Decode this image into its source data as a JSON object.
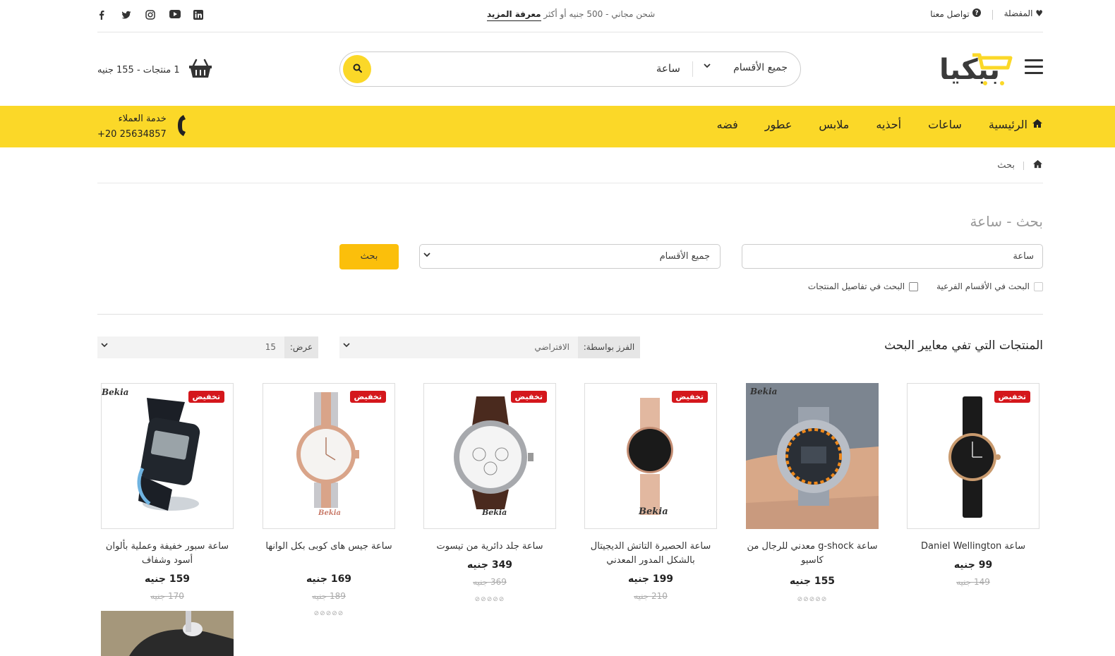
{
  "topbar": {
    "social_icons": [
      "facebook-icon",
      "twitter-icon",
      "instagram-icon",
      "youtube-icon",
      "linkedin-icon"
    ],
    "promo_text": "شحن مجاني - 500 جنيه أو أكثر",
    "promo_link": "معرفة المزيد",
    "favorites": "المفضلة",
    "contact": "تواصل معنا"
  },
  "header": {
    "logo_text": "بيكيا",
    "search": {
      "value": "ساعة",
      "category": "جميع الأقسام"
    },
    "cart": {
      "count": "1",
      "count_label": "منتجات",
      "sep": "-",
      "total": "155 جنيه"
    }
  },
  "nav": {
    "items": [
      "الرئيسية",
      "ساعات",
      "أحذيه",
      "ملابس",
      "عطور",
      "فضه"
    ],
    "support_label": "خدمة العملاء",
    "support_phone": "+20 25634857"
  },
  "breadcrumb": {
    "current": "بحث"
  },
  "search_form": {
    "title": "بحث - ساعة",
    "keyword": "ساعة",
    "category": "جميع الأقسام",
    "button": "بحث",
    "subcategories_label": "البحث في الأقسام الفرعية",
    "descriptions_label": "البحث في تفاصيل المنتجات"
  },
  "results": {
    "title": "المنتجات التي تفي معايير البحث",
    "sort_label": "الفرز بواسطة:",
    "sort_value": "الافتراضي",
    "show_label": "عرض:",
    "show_value": "15"
  },
  "colors": {
    "accent": "#fbd828",
    "button": "#fbbf0b",
    "badge": "#d4171c"
  },
  "products": [
    {
      "name": "ساعة Daniel Wellington",
      "price": "99 جنيه",
      "old_price": "149 جنيه",
      "badge": "تخفيض",
      "watermark": ""
    },
    {
      "name": "ساعة g-shock معدني للرجال من كاسيو",
      "price": "155 جنيه",
      "old_price": "",
      "badge": "",
      "watermark": "Bekia"
    },
    {
      "name": "ساعة الحصيرة التاتش الديجيتال بالشكل المدور المعدني",
      "price": "199 جنيه",
      "old_price": "210 جنيه",
      "badge": "تخفيض",
      "watermark": "Bekia"
    },
    {
      "name": "ساعة جلد دائرية من تيسوت",
      "price": "349 جنيه",
      "old_price": "369 جنيه",
      "badge": "تخفيض",
      "watermark": "Bekia"
    },
    {
      "name": "ساعة جيس هاى كوبى بكل الوانها",
      "price": "169 جنيه",
      "old_price": "189 جنيه",
      "badge": "تخفيض",
      "watermark": "Bekia"
    },
    {
      "name": "ساعة سبور خفيفة وعملية بألوان أسود وشفاف",
      "price": "159 جنيه",
      "old_price": "170 جنيه",
      "badge": "تخفيض",
      "watermark": "Bekia"
    }
  ]
}
